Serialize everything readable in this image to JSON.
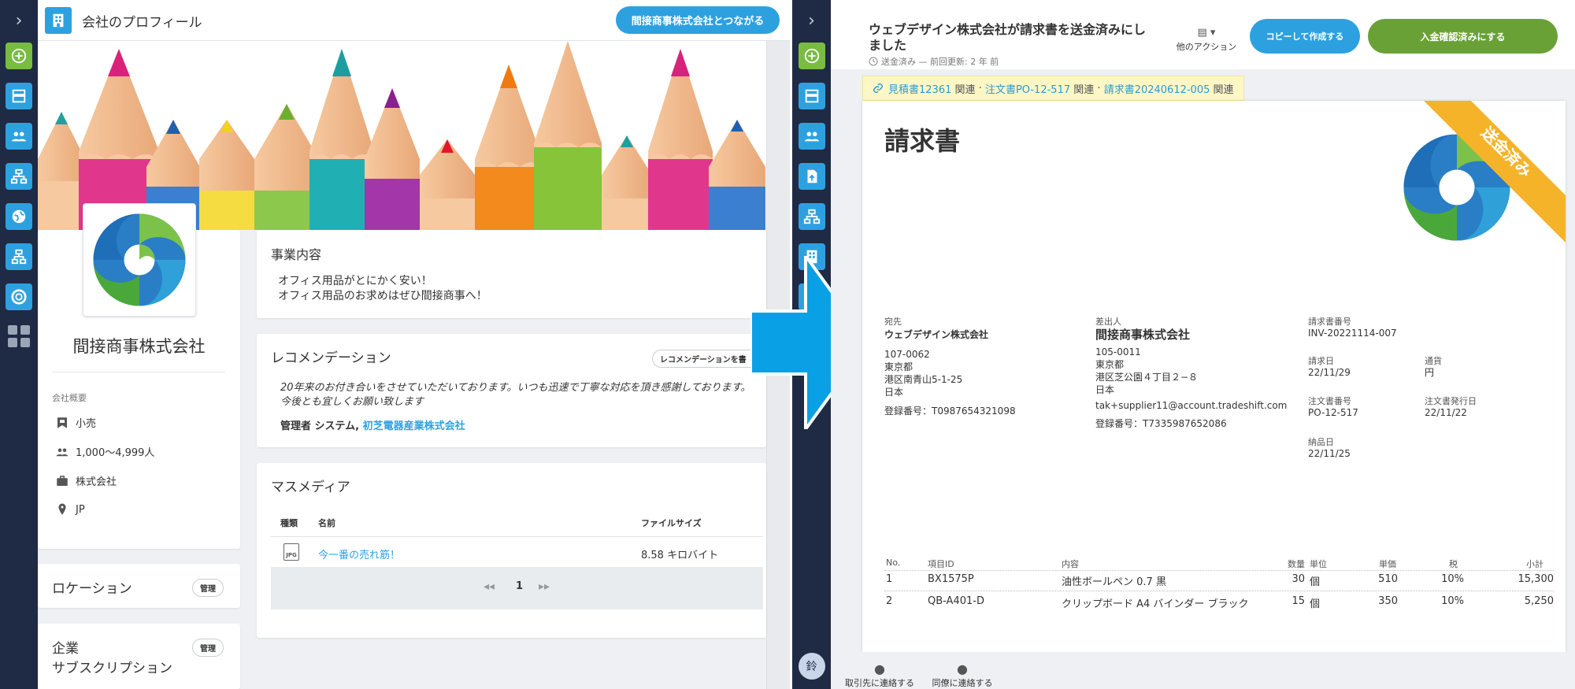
{
  "left_app": {
    "header": {
      "title": "会社のプロフィール",
      "connect_button": "間接商事株式会社とつながる"
    },
    "company": {
      "name": "間接商事株式会社",
      "overview_label": "会社概要",
      "info": [
        {
          "icon": "industry-icon",
          "text": "小売"
        },
        {
          "icon": "people-icon",
          "text": "1,000〜4,999人"
        },
        {
          "icon": "briefcase-icon",
          "text": "株式会社"
        },
        {
          "icon": "location-pin-icon",
          "text": "JP"
        }
      ]
    },
    "business": {
      "title": "事業内容",
      "lines": [
        "オフィス用品がとにかく安い！",
        "オフィス用品のお求めはぜひ間接商事へ！"
      ]
    },
    "recommendation": {
      "title": "レコメンデーション",
      "button": "レコメンデーションを書",
      "text": "20年来のお付き合いをさせていただいております。いつも迅速で丁寧な対応を頂き感謝しております。今後とも宜しくお願い致します",
      "author_prefix": "管理者 システム,",
      "author_company": "初芝電器産業株式会社"
    },
    "media": {
      "title": "マスメディア",
      "columns": [
        "種類",
        "名前",
        "ファイルサイズ"
      ],
      "rows": [
        {
          "type": "JPG",
          "name": "今一番の売れ筋！",
          "size": "8.58 キロバイト"
        }
      ],
      "page": "1"
    },
    "location": {
      "title": "ロケーション",
      "manage": "管理"
    },
    "subscription": {
      "title_line1": "企業",
      "title_line2": "サブスクリプション",
      "manage": "管理"
    }
  },
  "right_app": {
    "header": {
      "title_line1": "ウェブデザイン株式会社が請求書を送金済みにし",
      "title_line2": "ました",
      "status": "送金済み — 前回更新: 2 年 前",
      "other_actions": "他のアクション",
      "copy_button": "コピーして作成する",
      "confirm_button": "入金確認済みにする"
    },
    "related": {
      "links": [
        "見積書12361",
        "注文書PO-12-517",
        "請求書20240612-005"
      ],
      "suffix": "関連",
      "separator": "·"
    },
    "invoice": {
      "title": "請求書",
      "ribbon": "送金済み",
      "to": {
        "label": "宛先",
        "name": "ウェブデザイン株式会社",
        "lines": [
          "107-0062",
          "東京都",
          "港区南青山5-1-25",
          "日本"
        ],
        "reg": "登録番号：T0987654321098"
      },
      "from": {
        "label": "差出人",
        "name": "間接商事株式会社",
        "lines": [
          "105-0011",
          "東京都",
          "港区芝公園４丁目２−８",
          "日本",
          "tak+supplier11@account.tradeshift.com"
        ],
        "reg": "登録番号：T7335987652086"
      },
      "number": {
        "label": "請求書番号",
        "value": "INV-20221114-007"
      },
      "date": {
        "label": "請求日",
        "value": "22/11/29"
      },
      "currency": {
        "label": "通貨",
        "value": "円"
      },
      "po_number": {
        "label": "注文書番号",
        "value": "PO-12-517"
      },
      "po_date": {
        "label": "注文書発行日",
        "value": "22/11/22"
      },
      "delivery": {
        "label": "納品日",
        "value": "22/11/25"
      },
      "columns": [
        "No.",
        "項目ID",
        "内容",
        "数量",
        "単位",
        "単価",
        "税",
        "小計"
      ],
      "rows": [
        {
          "no": "1",
          "id": "BX1575P",
          "desc": "油性ボールペン 0.7 黒",
          "qty": "30",
          "unit": "個",
          "price": "510",
          "tax": "10%",
          "total": "15,300"
        },
        {
          "no": "2",
          "id": "QB-A401-D",
          "desc": "クリップボード A4 バインダー ブラック",
          "qty": "15",
          "unit": "個",
          "price": "350",
          "tax": "10%",
          "total": "5,250"
        }
      ]
    },
    "footer": {
      "contact_partner": "取引先に連絡する",
      "contact_colleague": "同僚に連絡する",
      "avatar": "鈴"
    }
  },
  "colors": {
    "sidebar": "#1f2a44",
    "accent_blue": "#2da1e0",
    "accent_green": "#78bc42",
    "confirm_green": "#6aa137",
    "ribbon": "#f5b32a"
  }
}
